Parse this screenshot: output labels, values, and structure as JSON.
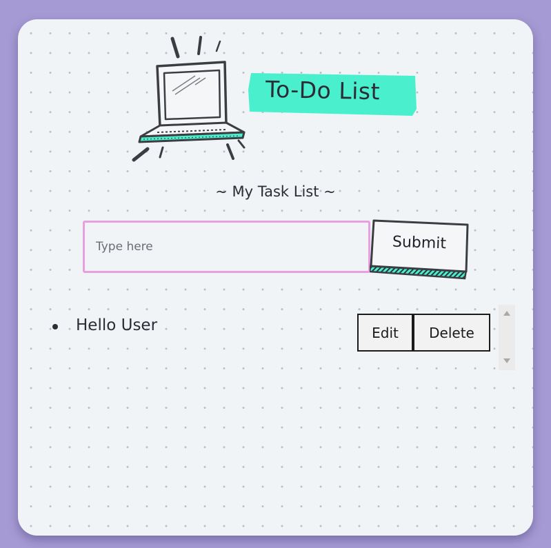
{
  "header": {
    "title": "To-Do List",
    "title_highlight_color": "#4af0cd",
    "illustration": "laptop-icon"
  },
  "subtitle": "~ My Task List ~",
  "form": {
    "input_placeholder": "Type here",
    "input_value": "",
    "input_border_color": "#e6a0df",
    "submit_label": "Submit"
  },
  "tasks": [
    {
      "text": "Hello User",
      "edit_label": "Edit",
      "delete_label": "Delete"
    }
  ],
  "colors": {
    "page_background": "#a69ad4",
    "card_background": "#f0f4f7",
    "accent": "#4af0cd"
  }
}
